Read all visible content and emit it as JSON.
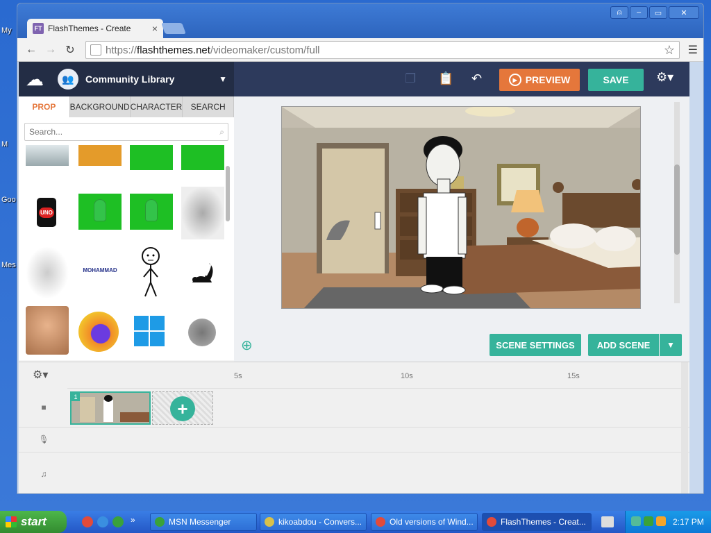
{
  "desktop": {
    "labels": [
      "My",
      "M",
      "Goo",
      "Mes"
    ]
  },
  "browser": {
    "tab_title": "FlashThemes - Create",
    "tab_favicon": "FT",
    "url_scheme": "https://",
    "url_host": "flashthemes.net",
    "url_path": "/videomaker/custom/full"
  },
  "app": {
    "library_title": "Community Library",
    "tabs": [
      "PROP",
      "BACKGROUND",
      "CHARACTER",
      "SEARCH"
    ],
    "active_tab": "PROP",
    "search_placeholder": "Search...",
    "preview_label": "PREVIEW",
    "save_label": "SAVE",
    "scene_settings_label": "SCENE SETTINGS",
    "add_scene_label": "ADD SCENE",
    "prop_text_thumb": "MOHAMMAD",
    "uno_label": "UNO",
    "colors": {
      "header_bg": "#2d3a5c",
      "accent_orange": "#e5773b",
      "accent_teal": "#36b39b"
    }
  },
  "timeline": {
    "marks": [
      "5s",
      "10s",
      "15s"
    ],
    "scene_number": "1"
  },
  "taskbar": {
    "start_label": "start",
    "tasks": [
      {
        "label": "MSN Messenger",
        "color": "#3aa23a"
      },
      {
        "label": "kikoabdou - Convers...",
        "color": "#d8c14a"
      },
      {
        "label": "Old versions of Wind...",
        "color": "#e24b3b"
      },
      {
        "label": "FlashThemes - Creat...",
        "color": "#e24b3b"
      }
    ],
    "clock": "2:17 PM"
  }
}
